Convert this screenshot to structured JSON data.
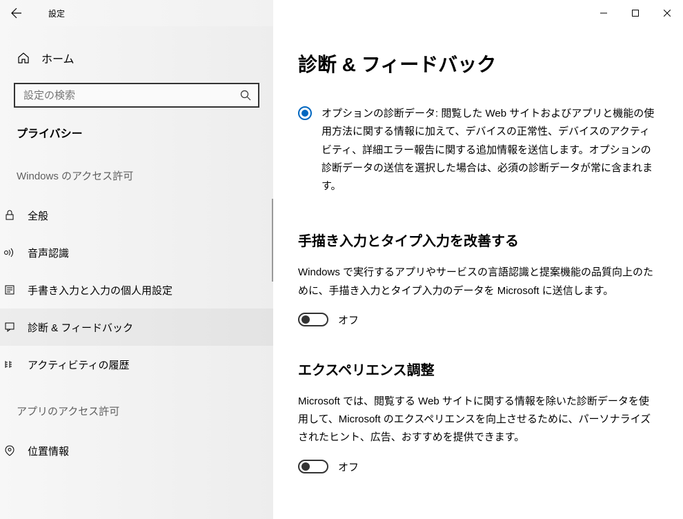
{
  "titlebar": {
    "title": "設定"
  },
  "sidebar": {
    "home": "ホーム",
    "search_placeholder": "設定の検索",
    "category": "プライバシー",
    "section1_label": "Windows のアクセス許可",
    "items1": [
      {
        "label": "全般"
      },
      {
        "label": "音声認識"
      },
      {
        "label": "手書き入力と入力の個人用設定"
      },
      {
        "label": "診断 & フィードバック",
        "active": true
      },
      {
        "label": "アクティビティの履歴"
      }
    ],
    "section2_label": "アプリのアクセス許可",
    "items2": [
      {
        "label": "位置情報"
      }
    ]
  },
  "main": {
    "page_title": "診断 & フィードバック",
    "radio_label": "オプションの診断データ: 閲覧した Web サイトおよびアプリと機能の使用方法に関する情報に加えて、デバイスの正常性、デバイスのアクティビティ、詳細エラー報告に関する追加情報を送信します。オプションの診断データの送信を選択した場合は、必須の診断データが常に含まれます。",
    "section_inking": {
      "heading": "手描き入力とタイプ入力を改善する",
      "desc": "Windows で実行するアプリやサービスの言語認識と提案機能の品質向上のために、手描き入力とタイプ入力のデータを Microsoft に送信します。",
      "toggle_state": "オフ"
    },
    "section_exp": {
      "heading": "エクスペリエンス調整",
      "desc": "Microsoft では、閲覧する Web サイトに関する情報を除いた診断データを使用して、Microsoft のエクスペリエンスを向上させるために、パーソナライズされたヒント、広告、おすすめを提供できます。",
      "toggle_state": "オフ"
    }
  }
}
